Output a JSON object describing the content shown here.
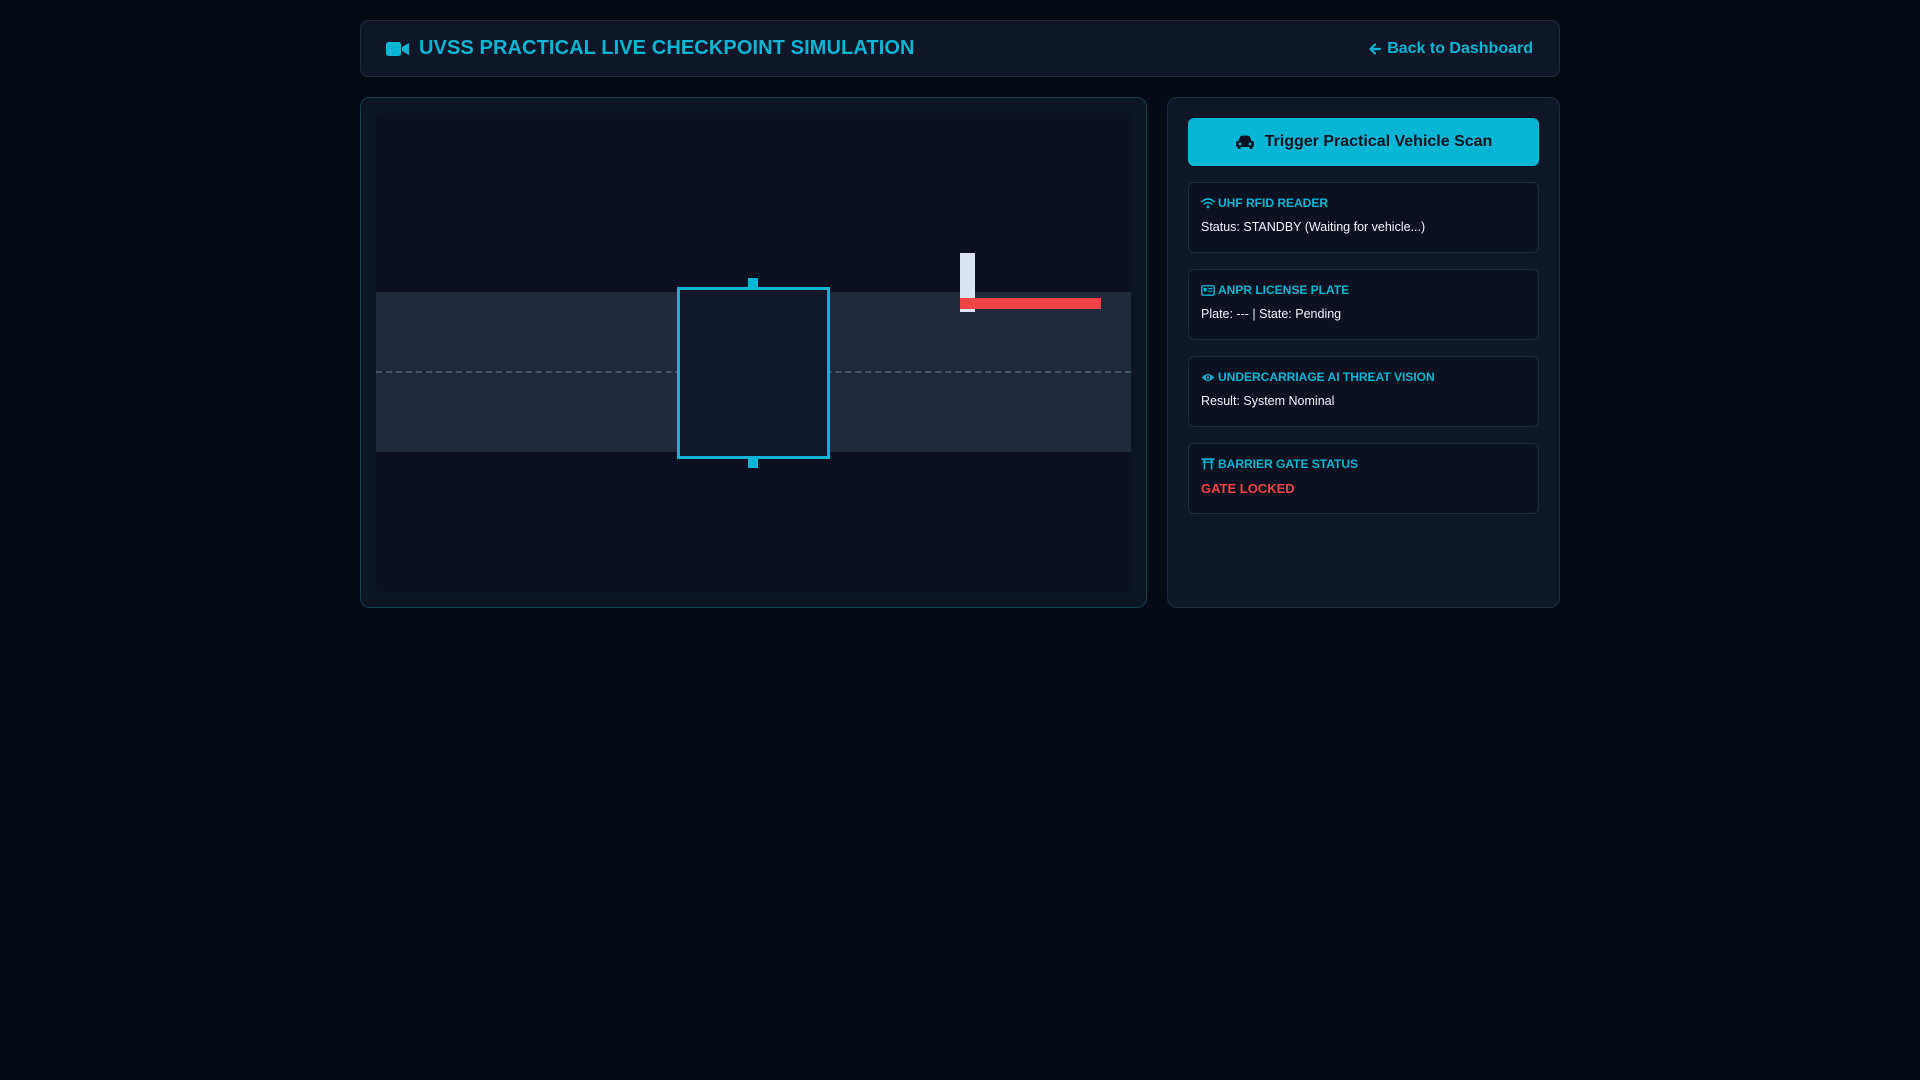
{
  "header": {
    "title": "UVSS PRACTICAL LIVE CHECKPOINT SIMULATION",
    "title_icon": "video-camera-icon",
    "back_label": "Back to Dashboard",
    "back_icon": "arrow-left-icon"
  },
  "simulation": {
    "gate_state": "closed"
  },
  "controls": {
    "trigger_label": "Trigger Practical Vehicle Scan",
    "trigger_icon": "car-icon"
  },
  "status_cards": [
    {
      "icon": "wifi-icon",
      "title": "UHF RFID READER",
      "text": "Status: STANDBY (Waiting for vehicle...)"
    },
    {
      "icon": "id-card-icon",
      "title": "ANPR LICENSE PLATE",
      "text": "Plate: --- | State: Pending"
    },
    {
      "icon": "eye-icon",
      "title": "UNDERCARRIAGE AI THREAT VISION",
      "text": "Result: System Nominal"
    },
    {
      "icon": "torii-gate-icon",
      "title": "BARRIER GATE STATUS",
      "text": "GATE LOCKED"
    }
  ],
  "colors": {
    "accent": "#06b6d4",
    "alert": "#ef4444",
    "background": "#050a14",
    "panel": "#0f1628"
  }
}
